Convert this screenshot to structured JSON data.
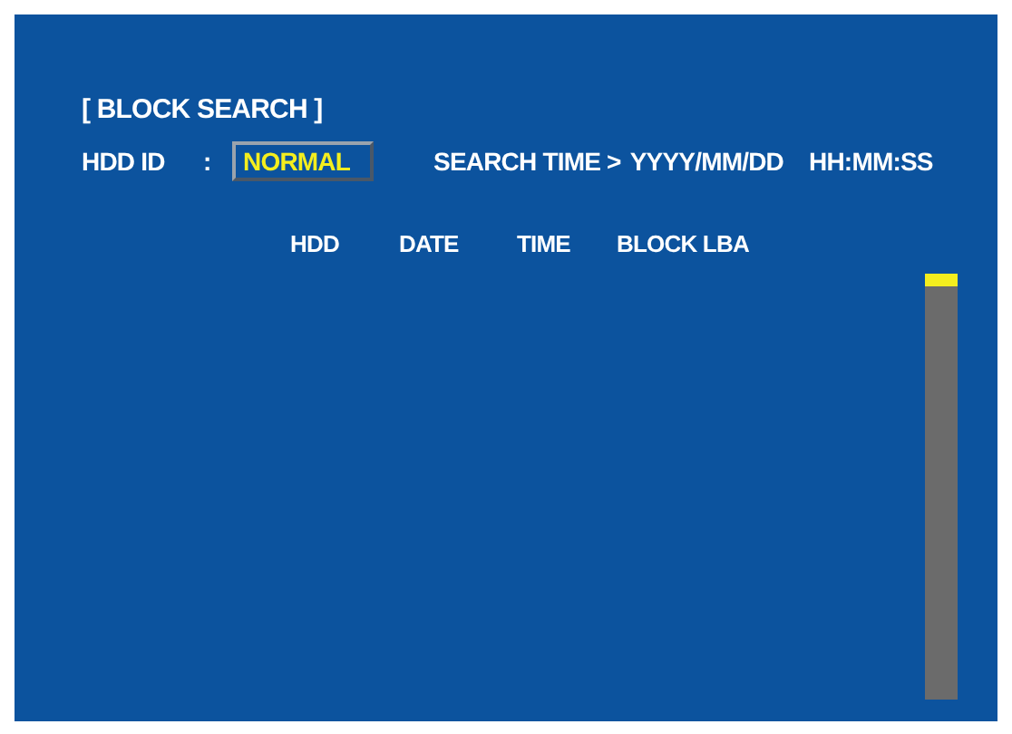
{
  "title": "[ BLOCK SEARCH ]",
  "hdd_id": {
    "label": "HDD ID",
    "separator": ":",
    "value": "NORMAL"
  },
  "search_time": {
    "label": "SEARCH TIME >",
    "date": "YYYY/MM/DD",
    "time": "HH:MM:SS"
  },
  "table": {
    "columns": [
      "HDD",
      "DATE",
      "TIME",
      "BLOCK LBA"
    ]
  }
}
